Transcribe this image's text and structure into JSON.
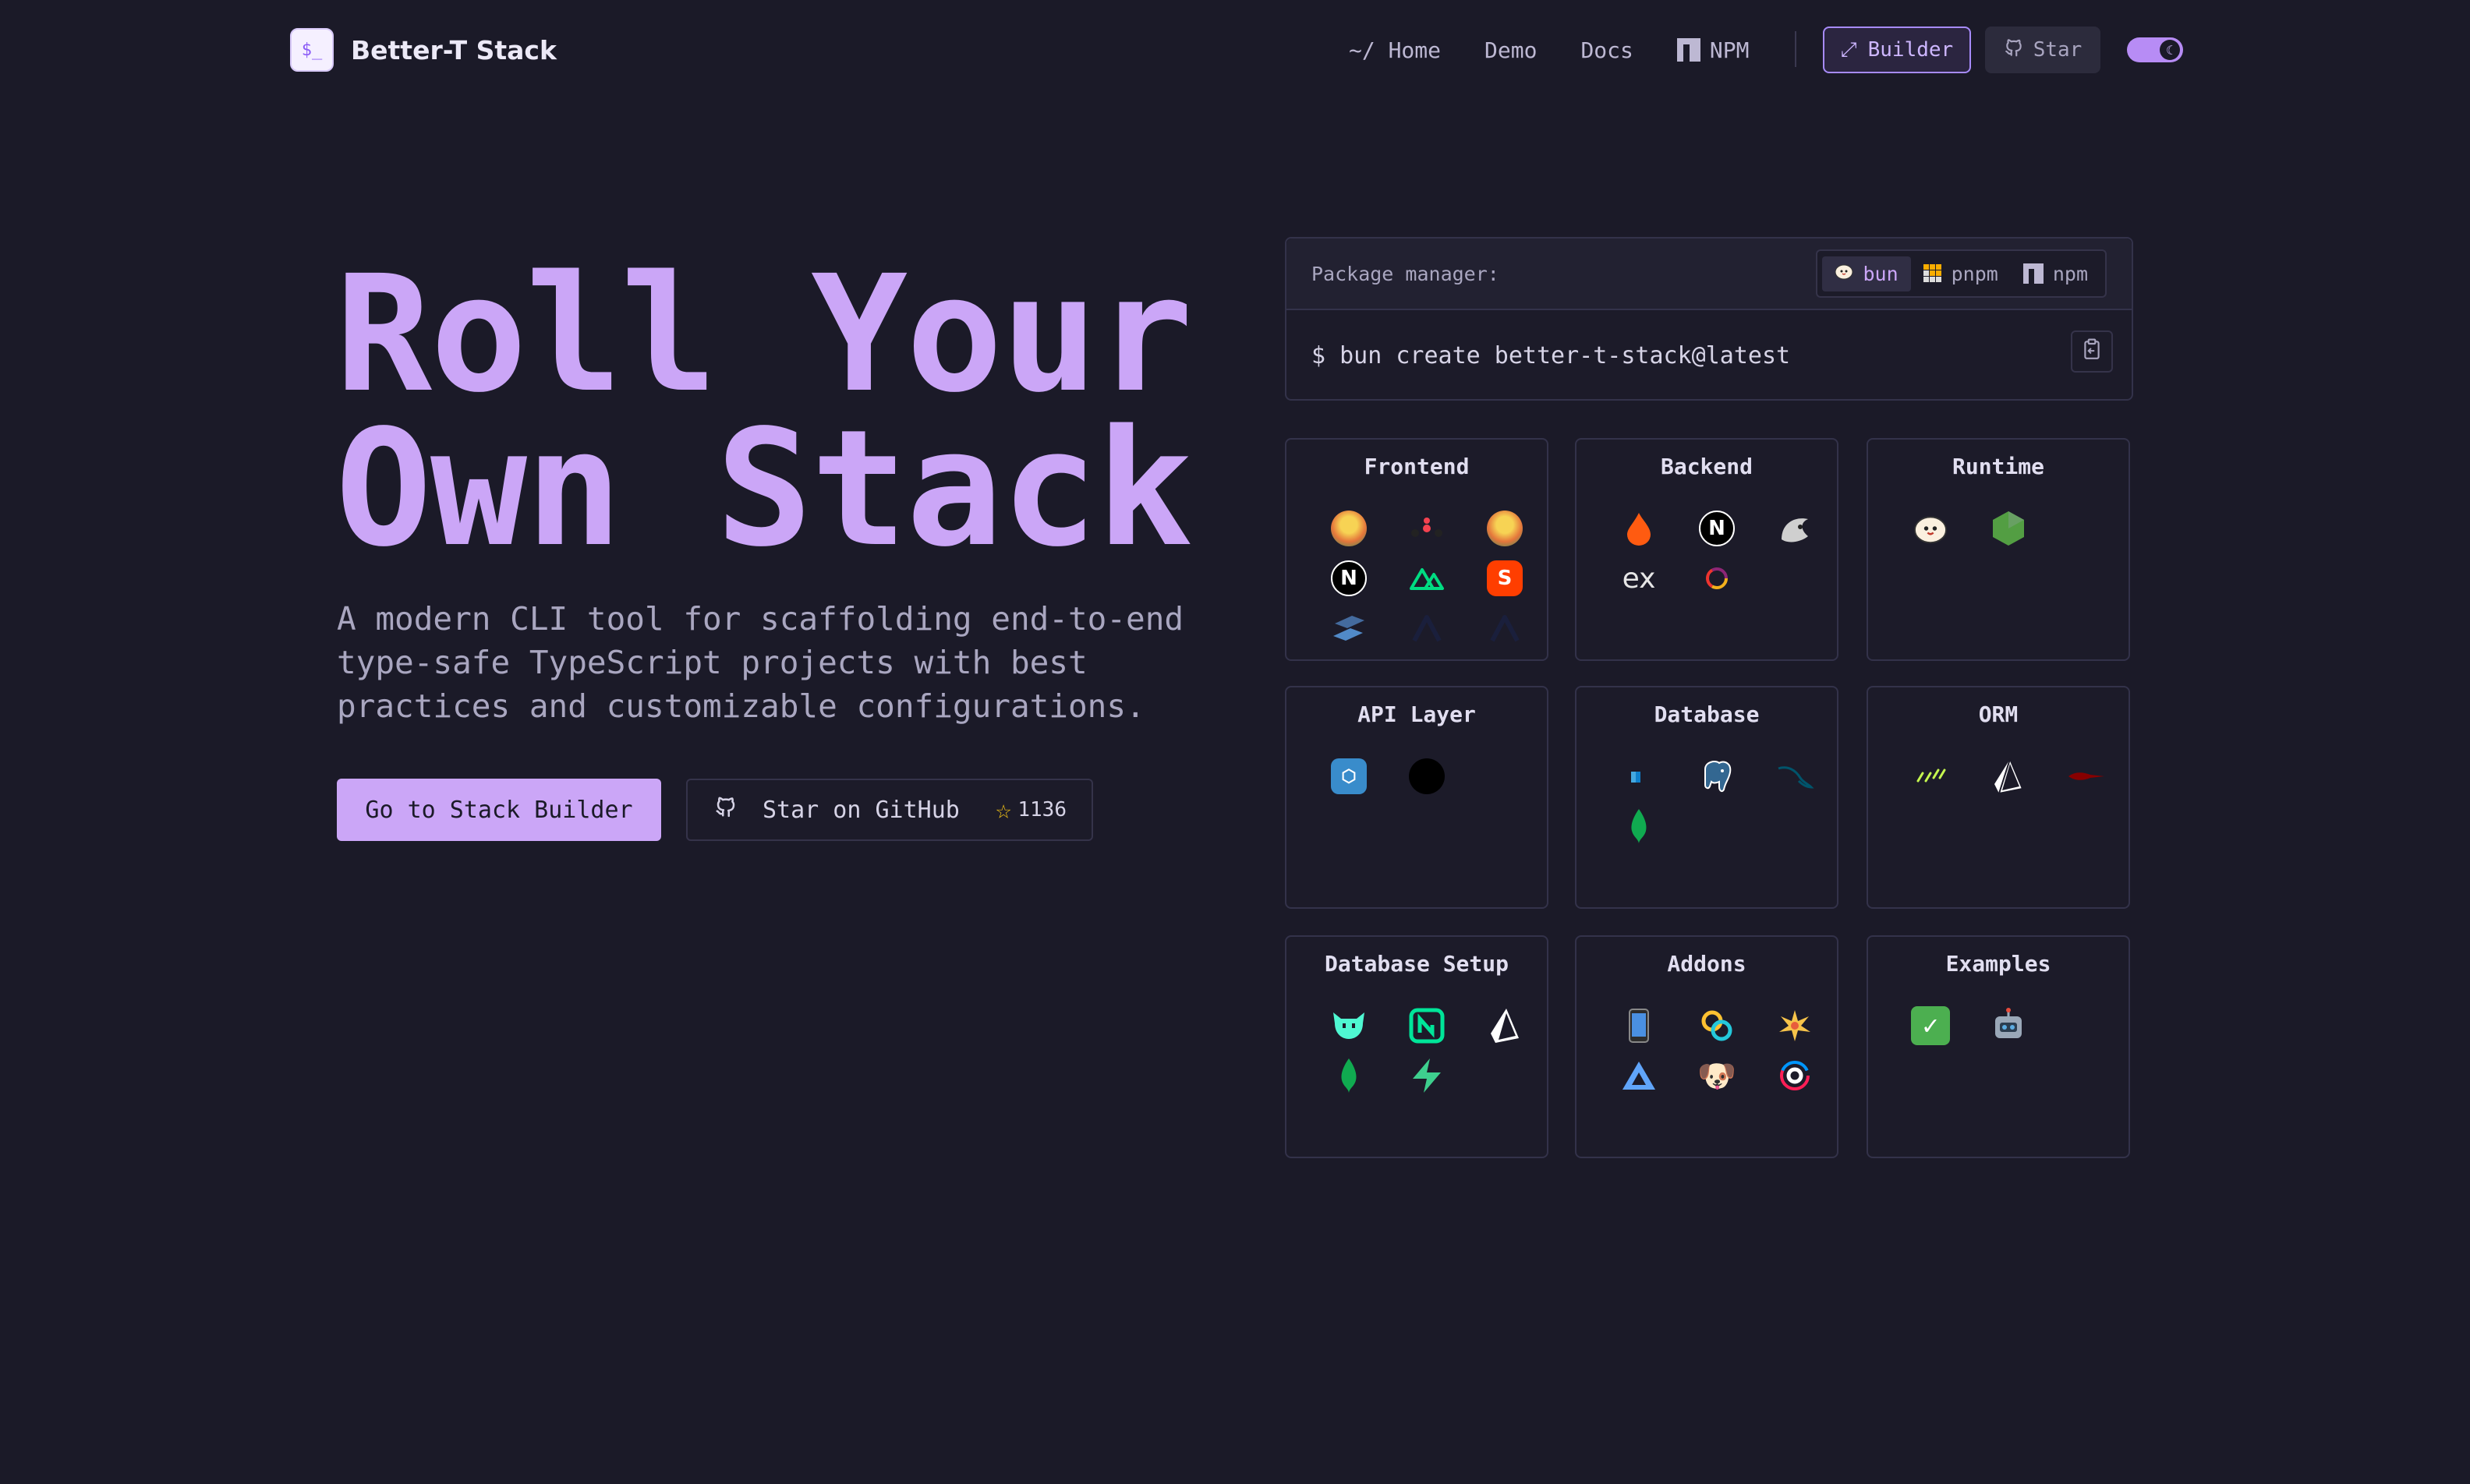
{
  "brand": {
    "logo": "$_",
    "name": "Better-T Stack"
  },
  "nav": {
    "home": "~/ Home",
    "demo": "Demo",
    "docs": "Docs",
    "npm": "NPM",
    "builder": "Builder",
    "star": "Star"
  },
  "hero": {
    "title_line1": "Roll Your",
    "title_line2": "Own Stack",
    "subtitle": "A modern CLI tool for scaffolding end-to-end type-safe TypeScript projects with best practices and customizable configurations.",
    "primary_cta": "Go to Stack Builder",
    "github_cta": "Star on GitHub",
    "star_count": "1136"
  },
  "command": {
    "label": "Package manager:",
    "options": [
      "bun",
      "pnpm",
      "npm"
    ],
    "selected": "bun",
    "text": "$ bun create better-t-stack@latest"
  },
  "categories": [
    {
      "title": "Frontend",
      "icons": [
        "tanstack-router-icon",
        "react-router-icon",
        "tanstack-start-icon",
        "next-icon",
        "nuxt-icon",
        "svelte-icon",
        "solid-icon",
        "native-icon",
        "native-unistyles-icon"
      ]
    },
    {
      "title": "Backend",
      "icons": [
        "hono-icon",
        "next-icon",
        "elysia-icon",
        "express-icon",
        "convex-icon"
      ]
    },
    {
      "title": "Runtime",
      "icons": [
        "bun-icon",
        "node-icon"
      ]
    },
    {
      "title": "API Layer",
      "icons": [
        "trpc-icon",
        "orpc-icon"
      ]
    },
    {
      "title": "Database",
      "icons": [
        "sqlite-icon",
        "postgres-icon",
        "mysql-icon",
        "mongodb-icon"
      ]
    },
    {
      "title": "ORM",
      "icons": [
        "drizzle-icon",
        "prisma-icon",
        "mongoose-icon"
      ]
    },
    {
      "title": "Database Setup",
      "icons": [
        "turso-icon",
        "neon-icon",
        "prisma-postgres-icon",
        "mongodb-atlas-icon",
        "supabase-icon"
      ]
    },
    {
      "title": "Addons",
      "icons": [
        "pwa-icon",
        "tauri-icon",
        "starlight-icon",
        "biome-icon",
        "husky-icon",
        "turborepo-icon"
      ]
    },
    {
      "title": "Examples",
      "icons": [
        "todo-icon",
        "ai-icon"
      ]
    }
  ],
  "colors": {
    "accent": "#cba6f7",
    "background": "#1b1a28",
    "border": "#33324a"
  }
}
